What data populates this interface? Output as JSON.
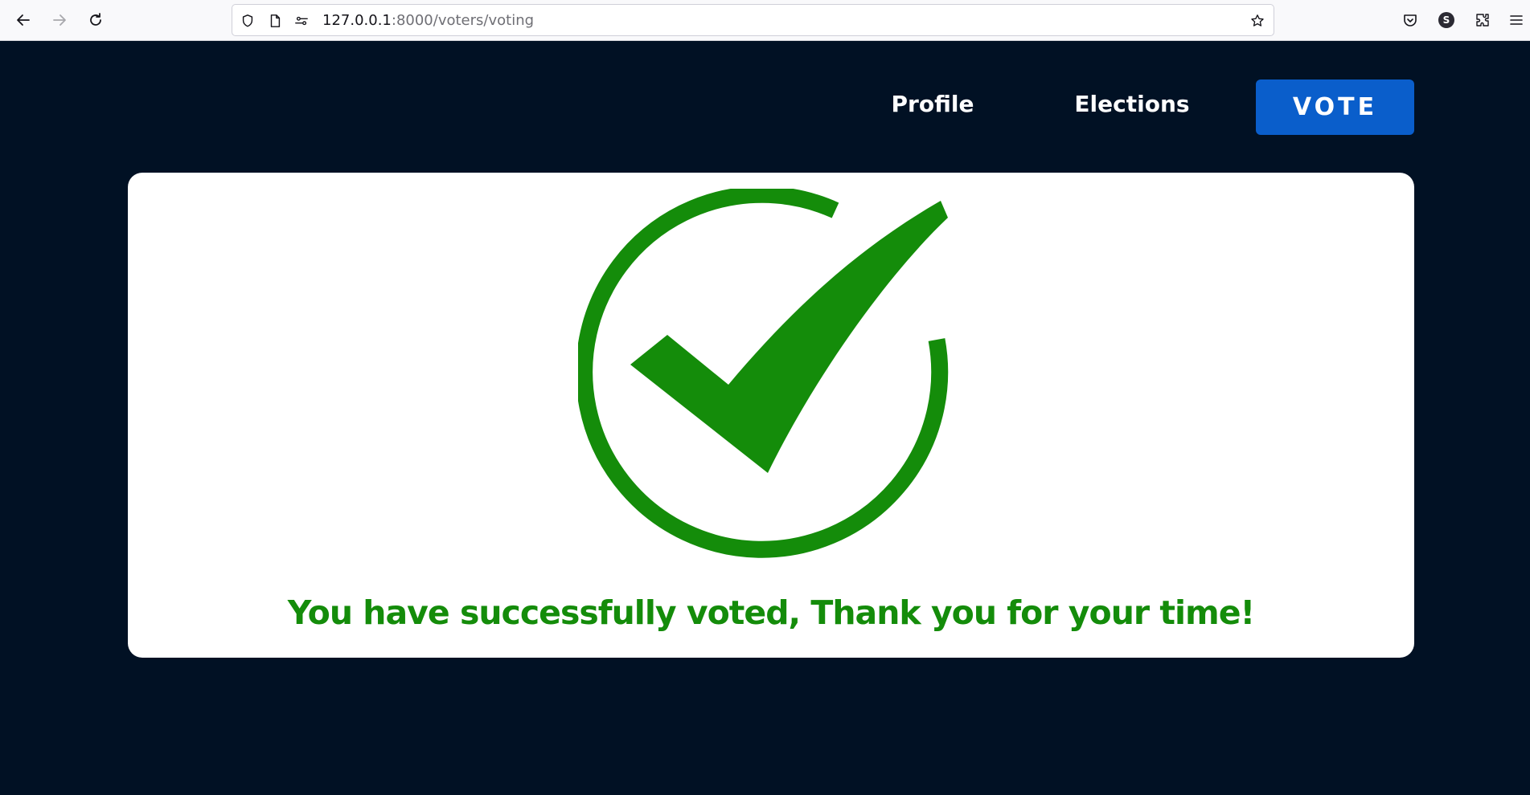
{
  "browser": {
    "url_host": "127.0.0.1",
    "url_path": ":8000/voters/voting",
    "profile_initial": "S",
    "icons": [
      "back-icon",
      "forward-icon",
      "reload-icon",
      "shield-icon",
      "page-icon",
      "permissions-icon",
      "bookmark-star-icon",
      "pocket-icon",
      "extensions-icon",
      "menu-icon"
    ]
  },
  "nav": {
    "profile_label": "Profile",
    "elections_label": "Elections",
    "vote_label": "VOTE"
  },
  "card": {
    "message": "You have successfully voted, Thank you for your time!",
    "icon": "success-check-icon"
  },
  "colors": {
    "page_background": "#011124",
    "accent_blue": "#0a5ecb",
    "success_green": "#148c0a",
    "card_background": "#ffffff"
  }
}
